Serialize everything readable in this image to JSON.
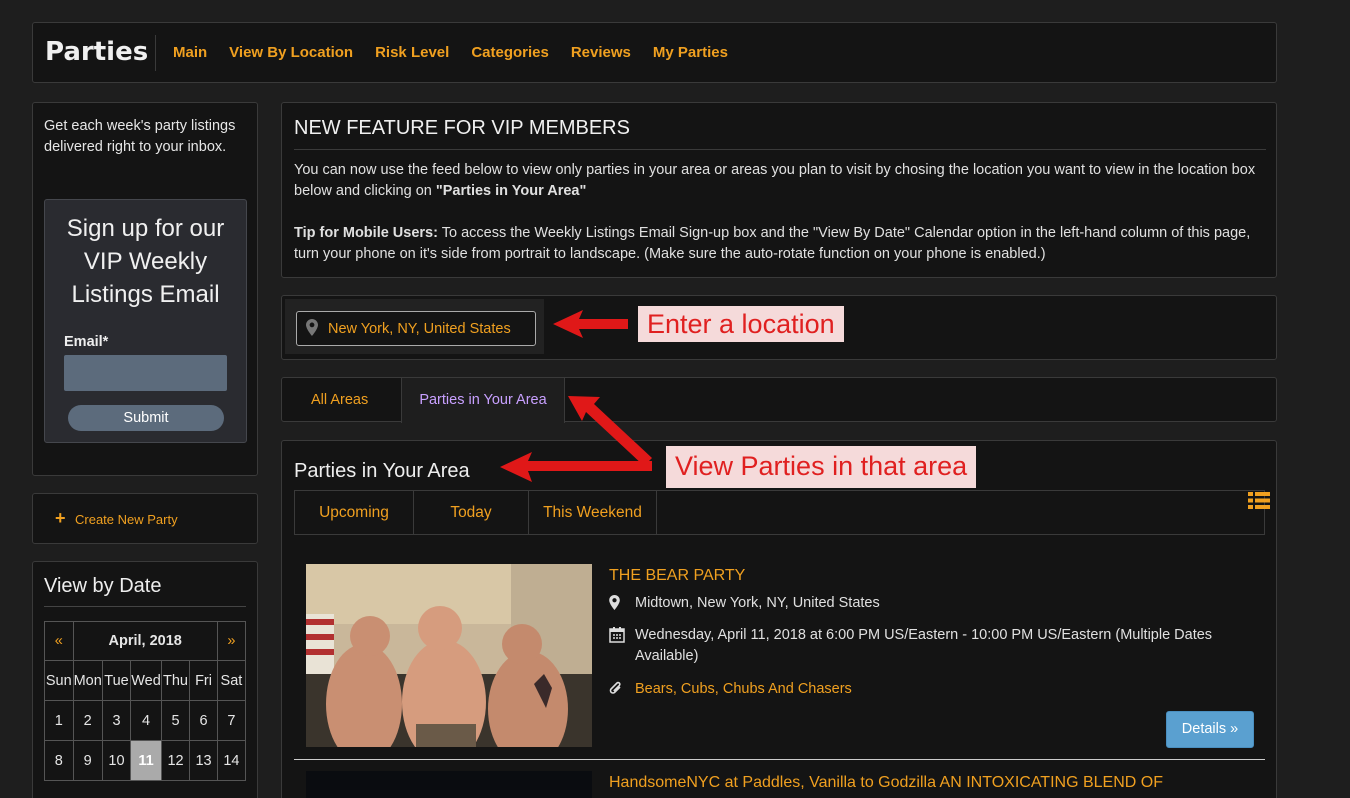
{
  "header": {
    "brand": "Parties",
    "nav": [
      "Main",
      "View By Location",
      "Risk Level",
      "Categories",
      "Reviews",
      "My Parties"
    ]
  },
  "sidebar": {
    "intro": "Get each week's party listings delivered right to your inbox.",
    "signup_title": "Sign up for our VIP Weekly Listings Email",
    "email_label": "Email*",
    "submit_label": "Submit",
    "create_label": "Create New Party",
    "calendar": {
      "title": "View by Date",
      "prev": "«",
      "month": "April, 2018",
      "next": "»",
      "weekdays": [
        "Sun",
        "Mon",
        "Tue",
        "Wed",
        "Thu",
        "Fri",
        "Sat"
      ],
      "rows": [
        [
          "1",
          "2",
          "3",
          "4",
          "5",
          "6",
          "7"
        ],
        [
          "8",
          "9",
          "10",
          "11",
          "12",
          "13",
          "14"
        ]
      ],
      "today": "11"
    }
  },
  "feature": {
    "title": "NEW FEATURE FOR VIP MEMBERS",
    "body_before": "You can now use the feed below to view only parties in your area or areas you plan to visit by chosing the location you want to view in the location box below and clicking on ",
    "body_strong": "\"Parties in Your Area\"",
    "tip_label": "Tip for Mobile Users:",
    "tip_text": " To access the Weekly Listings Email Sign-up box and the \"View By Date\" Calendar option in the left-hand column of this page, turn your phone on it's side from portrait to landscape. (Make sure the auto-rotate function on your phone is enabled.)"
  },
  "location": {
    "value": "New York, NY, United States"
  },
  "area_tabs": [
    "All Areas",
    "Parties in Your Area"
  ],
  "section": {
    "title": "Parties in Your Area",
    "subtabs": [
      "Upcoming",
      "Today",
      "This Weekend"
    ]
  },
  "events": [
    {
      "title": "THE BEAR PARTY",
      "location": "Midtown, New York, NY, United States",
      "datetime": "Wednesday, April 11, 2018 at 6:00 PM US/Eastern - 10:00 PM US/Eastern (Multiple Dates Available)",
      "categories": "Bears, Cubs, Chubs And Chasers",
      "details_label": "Details »"
    },
    {
      "title": "HandsomeNYC at Paddles, Vanilla to Godzilla AN INTOXICATING BLEND OF"
    }
  ],
  "annotations": {
    "enter_location": "Enter a location",
    "view_parties": "View Parties in that area"
  },
  "colors": {
    "accent": "#f0a020",
    "active_tab": "#c8a0ff",
    "annotation_red": "#e02020",
    "annotation_bg": "#f5dada",
    "details_button": "#5aa0d0"
  }
}
